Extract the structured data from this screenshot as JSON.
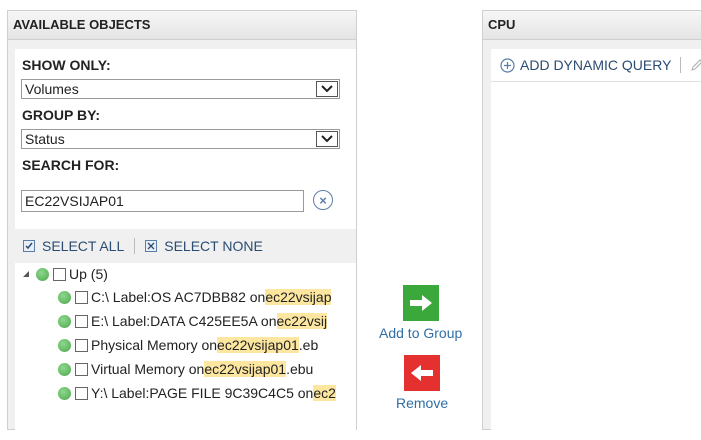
{
  "left_panel": {
    "title": "AVAILABLE OBJECTS",
    "show_only": {
      "label": "SHOW ONLY:",
      "value": "Volumes"
    },
    "group_by": {
      "label": "GROUP BY:",
      "value": "Status"
    },
    "search": {
      "label": "SEARCH FOR:",
      "value": "EC22VSIJAP01"
    },
    "select_all": "SELECT ALL",
    "select_none": "SELECT NONE",
    "tree": {
      "group_label": "Up (5)",
      "items": [
        {
          "before": "C:\\ Label:OS AC7DBB82 on ",
          "match": "ec22vsijap",
          "after": ""
        },
        {
          "before": "E:\\ Label:DATA C425EE5A on ",
          "match": "ec22vsij",
          "after": ""
        },
        {
          "before": "Physical Memory on ",
          "match": "ec22vsijap01",
          "after": ".eb"
        },
        {
          "before": "Virtual Memory on ",
          "match": "ec22vsijap01",
          "after": ".ebu"
        },
        {
          "before": "Y:\\ Label:PAGE FILE 9C39C4C5 on ",
          "match": "ec2",
          "after": ""
        }
      ]
    }
  },
  "actions": {
    "add_label": "Add to Group",
    "remove_label": "Remove"
  },
  "right_panel": {
    "title": "CPU",
    "add_dynamic_query": "ADD DYNAMIC QUERY"
  },
  "colors": {
    "status_up": "#5cb85c",
    "highlight": "#fde7a0",
    "add_button": "#3aa83a",
    "remove_button": "#e53030",
    "link": "#2f6ea8"
  }
}
